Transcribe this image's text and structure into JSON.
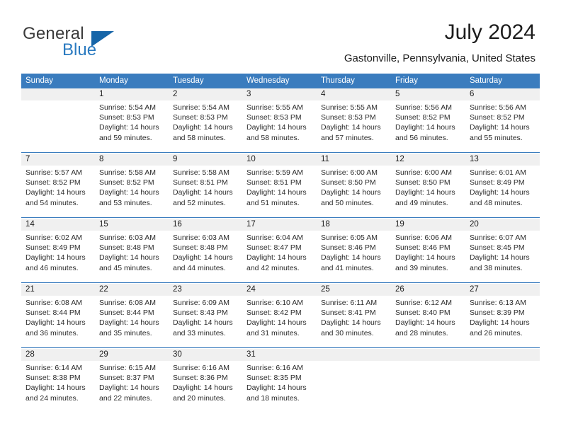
{
  "brand": {
    "name_part1": "General",
    "name_part2": "Blue",
    "logo_icon": "triangle-logo-icon"
  },
  "header": {
    "title": "July 2024",
    "subtitle": "Gastonville, Pennsylvania, United States"
  },
  "colors": {
    "header_blue": "#3a7cbe",
    "brand_blue": "#2a7ac0",
    "logo_blue": "#1665a8",
    "daynum_band": "#f0f0f0",
    "text": "#2b2b2b"
  },
  "calendar": {
    "weekday_headers": [
      "Sunday",
      "Monday",
      "Tuesday",
      "Wednesday",
      "Thursday",
      "Friday",
      "Saturday"
    ],
    "weeks": [
      [
        {
          "day": "",
          "lines": []
        },
        {
          "day": "1",
          "lines": [
            "Sunrise: 5:54 AM",
            "Sunset: 8:53 PM",
            "Daylight: 14 hours",
            "and 59 minutes."
          ]
        },
        {
          "day": "2",
          "lines": [
            "Sunrise: 5:54 AM",
            "Sunset: 8:53 PM",
            "Daylight: 14 hours",
            "and 58 minutes."
          ]
        },
        {
          "day": "3",
          "lines": [
            "Sunrise: 5:55 AM",
            "Sunset: 8:53 PM",
            "Daylight: 14 hours",
            "and 58 minutes."
          ]
        },
        {
          "day": "4",
          "lines": [
            "Sunrise: 5:55 AM",
            "Sunset: 8:53 PM",
            "Daylight: 14 hours",
            "and 57 minutes."
          ]
        },
        {
          "day": "5",
          "lines": [
            "Sunrise: 5:56 AM",
            "Sunset: 8:52 PM",
            "Daylight: 14 hours",
            "and 56 minutes."
          ]
        },
        {
          "day": "6",
          "lines": [
            "Sunrise: 5:56 AM",
            "Sunset: 8:52 PM",
            "Daylight: 14 hours",
            "and 55 minutes."
          ]
        }
      ],
      [
        {
          "day": "7",
          "lines": [
            "Sunrise: 5:57 AM",
            "Sunset: 8:52 PM",
            "Daylight: 14 hours",
            "and 54 minutes."
          ]
        },
        {
          "day": "8",
          "lines": [
            "Sunrise: 5:58 AM",
            "Sunset: 8:52 PM",
            "Daylight: 14 hours",
            "and 53 minutes."
          ]
        },
        {
          "day": "9",
          "lines": [
            "Sunrise: 5:58 AM",
            "Sunset: 8:51 PM",
            "Daylight: 14 hours",
            "and 52 minutes."
          ]
        },
        {
          "day": "10",
          "lines": [
            "Sunrise: 5:59 AM",
            "Sunset: 8:51 PM",
            "Daylight: 14 hours",
            "and 51 minutes."
          ]
        },
        {
          "day": "11",
          "lines": [
            "Sunrise: 6:00 AM",
            "Sunset: 8:50 PM",
            "Daylight: 14 hours",
            "and 50 minutes."
          ]
        },
        {
          "day": "12",
          "lines": [
            "Sunrise: 6:00 AM",
            "Sunset: 8:50 PM",
            "Daylight: 14 hours",
            "and 49 minutes."
          ]
        },
        {
          "day": "13",
          "lines": [
            "Sunrise: 6:01 AM",
            "Sunset: 8:49 PM",
            "Daylight: 14 hours",
            "and 48 minutes."
          ]
        }
      ],
      [
        {
          "day": "14",
          "lines": [
            "Sunrise: 6:02 AM",
            "Sunset: 8:49 PM",
            "Daylight: 14 hours",
            "and 46 minutes."
          ]
        },
        {
          "day": "15",
          "lines": [
            "Sunrise: 6:03 AM",
            "Sunset: 8:48 PM",
            "Daylight: 14 hours",
            "and 45 minutes."
          ]
        },
        {
          "day": "16",
          "lines": [
            "Sunrise: 6:03 AM",
            "Sunset: 8:48 PM",
            "Daylight: 14 hours",
            "and 44 minutes."
          ]
        },
        {
          "day": "17",
          "lines": [
            "Sunrise: 6:04 AM",
            "Sunset: 8:47 PM",
            "Daylight: 14 hours",
            "and 42 minutes."
          ]
        },
        {
          "day": "18",
          "lines": [
            "Sunrise: 6:05 AM",
            "Sunset: 8:46 PM",
            "Daylight: 14 hours",
            "and 41 minutes."
          ]
        },
        {
          "day": "19",
          "lines": [
            "Sunrise: 6:06 AM",
            "Sunset: 8:46 PM",
            "Daylight: 14 hours",
            "and 39 minutes."
          ]
        },
        {
          "day": "20",
          "lines": [
            "Sunrise: 6:07 AM",
            "Sunset: 8:45 PM",
            "Daylight: 14 hours",
            "and 38 minutes."
          ]
        }
      ],
      [
        {
          "day": "21",
          "lines": [
            "Sunrise: 6:08 AM",
            "Sunset: 8:44 PM",
            "Daylight: 14 hours",
            "and 36 minutes."
          ]
        },
        {
          "day": "22",
          "lines": [
            "Sunrise: 6:08 AM",
            "Sunset: 8:44 PM",
            "Daylight: 14 hours",
            "and 35 minutes."
          ]
        },
        {
          "day": "23",
          "lines": [
            "Sunrise: 6:09 AM",
            "Sunset: 8:43 PM",
            "Daylight: 14 hours",
            "and 33 minutes."
          ]
        },
        {
          "day": "24",
          "lines": [
            "Sunrise: 6:10 AM",
            "Sunset: 8:42 PM",
            "Daylight: 14 hours",
            "and 31 minutes."
          ]
        },
        {
          "day": "25",
          "lines": [
            "Sunrise: 6:11 AM",
            "Sunset: 8:41 PM",
            "Daylight: 14 hours",
            "and 30 minutes."
          ]
        },
        {
          "day": "26",
          "lines": [
            "Sunrise: 6:12 AM",
            "Sunset: 8:40 PM",
            "Daylight: 14 hours",
            "and 28 minutes."
          ]
        },
        {
          "day": "27",
          "lines": [
            "Sunrise: 6:13 AM",
            "Sunset: 8:39 PM",
            "Daylight: 14 hours",
            "and 26 minutes."
          ]
        }
      ],
      [
        {
          "day": "28",
          "lines": [
            "Sunrise: 6:14 AM",
            "Sunset: 8:38 PM",
            "Daylight: 14 hours",
            "and 24 minutes."
          ]
        },
        {
          "day": "29",
          "lines": [
            "Sunrise: 6:15 AM",
            "Sunset: 8:37 PM",
            "Daylight: 14 hours",
            "and 22 minutes."
          ]
        },
        {
          "day": "30",
          "lines": [
            "Sunrise: 6:16 AM",
            "Sunset: 8:36 PM",
            "Daylight: 14 hours",
            "and 20 minutes."
          ]
        },
        {
          "day": "31",
          "lines": [
            "Sunrise: 6:16 AM",
            "Sunset: 8:35 PM",
            "Daylight: 14 hours",
            "and 18 minutes."
          ]
        },
        {
          "day": "",
          "lines": []
        },
        {
          "day": "",
          "lines": []
        },
        {
          "day": "",
          "lines": []
        }
      ]
    ]
  }
}
